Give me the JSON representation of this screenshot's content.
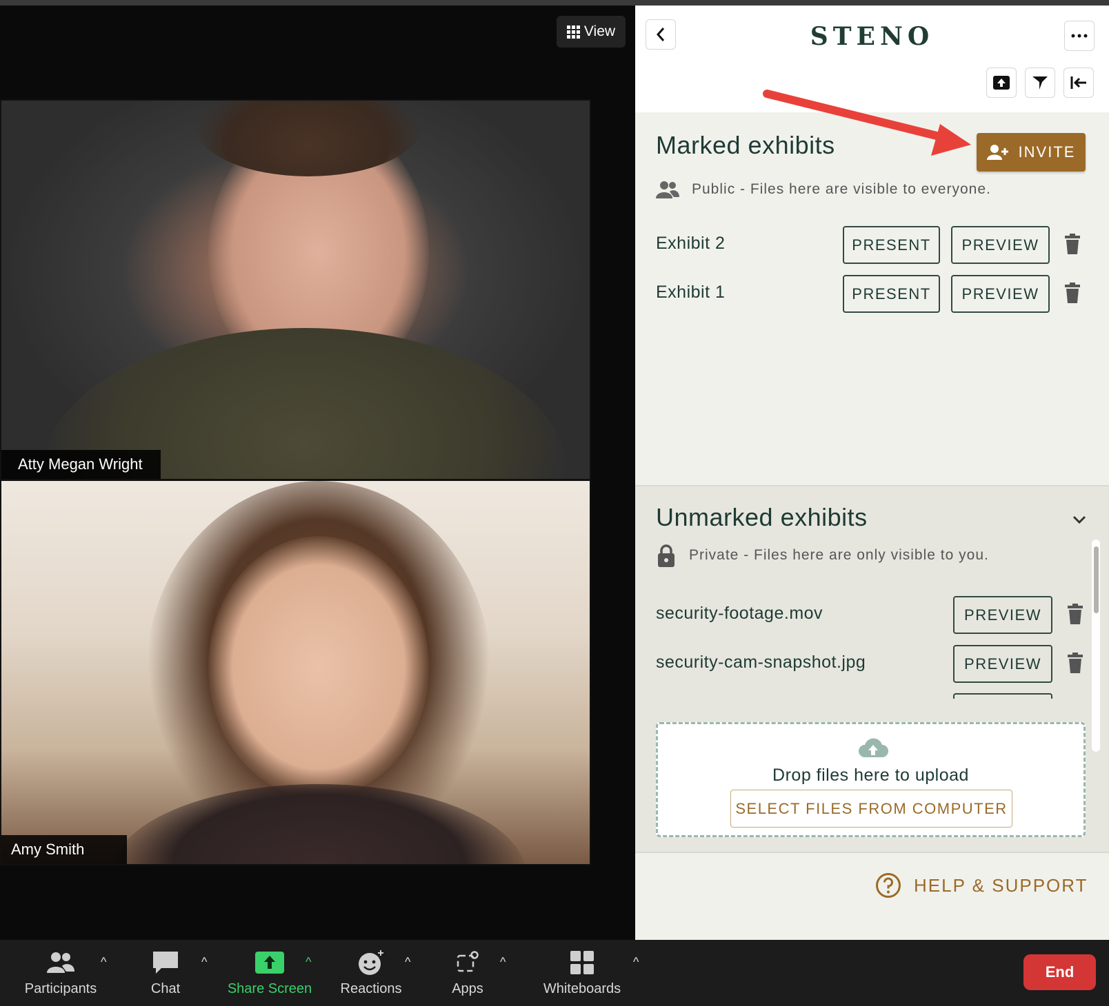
{
  "video": {
    "view_label": "View",
    "participants": [
      {
        "name": "Atty Megan Wright"
      },
      {
        "name": "Amy Smith"
      }
    ]
  },
  "toolbar": {
    "participants": "Participants",
    "chat": "Chat",
    "share_screen": "Share Screen",
    "reactions": "Reactions",
    "apps": "Apps",
    "whiteboards": "Whiteboards",
    "end": "End"
  },
  "panel": {
    "logo": "STENO",
    "marked": {
      "title": "Marked exhibits",
      "invite_label": "INVITE",
      "privacy_text": "Public - Files here are visible to everyone.",
      "items": [
        {
          "label": "Exhibit 2",
          "present": "PRESENT",
          "preview": "PREVIEW"
        },
        {
          "label": "Exhibit 1",
          "present": "PRESENT",
          "preview": "PREVIEW"
        }
      ]
    },
    "unmarked": {
      "title": "Unmarked exhibits",
      "privacy_text": "Private - Files here are only visible to you.",
      "items": [
        {
          "label": "security-footage.mov",
          "preview": "PREVIEW"
        },
        {
          "label": "security-cam-snapshot.jpg",
          "preview": "PREVIEW"
        }
      ]
    },
    "dropzone": {
      "text": "Drop files here to upload",
      "button": "SELECT FILES FROM COMPUTER"
    },
    "help_label": "HELP & SUPPORT"
  },
  "colors": {
    "accent_brown": "#9b6a28",
    "steno_green": "#1e3a34",
    "share_green": "#3ad06a",
    "end_red": "#d43636",
    "annotation_arrow": "#e8413a"
  },
  "icons": [
    "view-grid-icon",
    "participants-icon",
    "chat-icon",
    "share-screen-icon",
    "reactions-icon",
    "apps-icon",
    "whiteboards-icon",
    "back-chevron-icon",
    "more-icon",
    "upload-icon",
    "filter-icon",
    "collapse-icon",
    "add-user-icon",
    "people-icon",
    "lock-icon",
    "trash-icon",
    "chevron-down-icon",
    "cloud-upload-icon",
    "help-icon"
  ]
}
